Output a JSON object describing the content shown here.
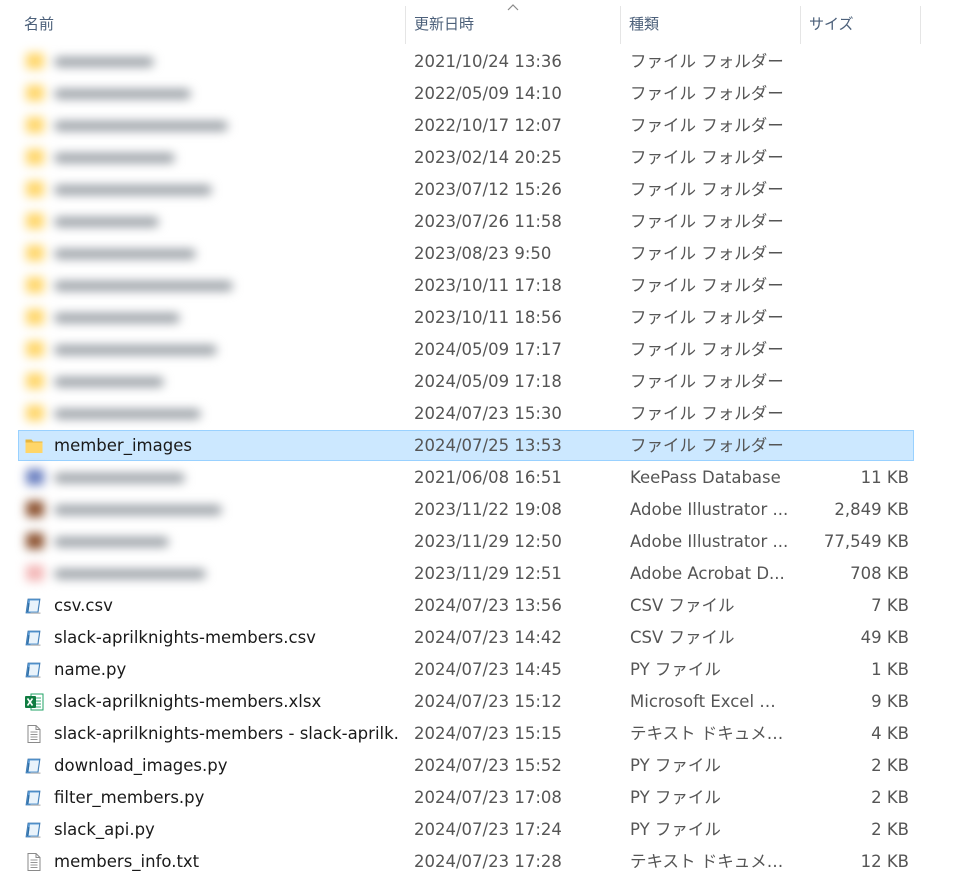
{
  "header": {
    "name_label": "名前",
    "date_label": "更新日時",
    "type_label": "種類",
    "size_label": "サイズ"
  },
  "colors": {
    "selection_bg": "#cce8ff",
    "selection_border": "#99d1ff",
    "header_text": "#4c607a",
    "secondary_text": "#555555",
    "folder_yellow": "#ffd669"
  },
  "rows": [
    {
      "name": "",
      "blurred": true,
      "icon": "folder-icon",
      "date": "2021/10/24 13:36",
      "type": "ファイル フォルダー",
      "size": ""
    },
    {
      "name": "",
      "blurred": true,
      "icon": "folder-icon",
      "date": "2022/05/09 14:10",
      "type": "ファイル フォルダー",
      "size": ""
    },
    {
      "name": "",
      "blurred": true,
      "icon": "folder-icon",
      "date": "2022/10/17 12:07",
      "type": "ファイル フォルダー",
      "size": ""
    },
    {
      "name": "",
      "blurred": true,
      "icon": "folder-icon",
      "date": "2023/02/14 20:25",
      "type": "ファイル フォルダー",
      "size": ""
    },
    {
      "name": "",
      "blurred": true,
      "icon": "folder-icon",
      "date": "2023/07/12 15:26",
      "type": "ファイル フォルダー",
      "size": ""
    },
    {
      "name": "",
      "blurred": true,
      "icon": "folder-icon",
      "date": "2023/07/26 11:58",
      "type": "ファイル フォルダー",
      "size": ""
    },
    {
      "name": "",
      "blurred": true,
      "icon": "folder-icon",
      "date": "2023/08/23 9:50",
      "type": "ファイル フォルダー",
      "size": ""
    },
    {
      "name": "",
      "blurred": true,
      "icon": "folder-icon",
      "date": "2023/10/11 17:18",
      "type": "ファイル フォルダー",
      "size": ""
    },
    {
      "name": "",
      "blurred": true,
      "icon": "folder-icon",
      "date": "2023/10/11 18:56",
      "type": "ファイル フォルダー",
      "size": ""
    },
    {
      "name": "",
      "blurred": true,
      "icon": "folder-icon",
      "date": "2024/05/09 17:17",
      "type": "ファイル フォルダー",
      "size": ""
    },
    {
      "name": "",
      "blurred": true,
      "icon": "folder-icon",
      "date": "2024/05/09 17:18",
      "type": "ファイル フォルダー",
      "size": ""
    },
    {
      "name": "",
      "blurred": true,
      "icon": "folder-icon",
      "date": "2024/07/23 15:30",
      "type": "ファイル フォルダー",
      "size": ""
    },
    {
      "name": "member_images",
      "blurred": false,
      "selected": true,
      "icon": "folder-icon",
      "date": "2024/07/25 13:53",
      "type": "ファイル フォルダー",
      "size": ""
    },
    {
      "name": "",
      "blurred": true,
      "icon": "keepass-icon",
      "date": "2021/06/08 16:51",
      "type": "KeePass Database",
      "size": "11 KB"
    },
    {
      "name": "",
      "blurred": true,
      "icon": "illustrator-icon",
      "date": "2023/11/22 19:08",
      "type": "Adobe Illustrator ...",
      "size": "2,849 KB"
    },
    {
      "name": "",
      "blurred": true,
      "icon": "illustrator-icon",
      "date": "2023/11/29 12:50",
      "type": "Adobe Illustrator ...",
      "size": "77,549 KB"
    },
    {
      "name": "",
      "blurred": true,
      "icon": "pdf-icon",
      "date": "2023/11/29 12:51",
      "type": "Adobe Acrobat D...",
      "size": "708 KB"
    },
    {
      "name": "csv.csv",
      "blurred": false,
      "icon": "script-file-icon",
      "date": "2024/07/23 13:56",
      "type": "CSV ファイル",
      "size": "7 KB"
    },
    {
      "name": "slack-aprilknights-members.csv",
      "blurred": false,
      "icon": "script-file-icon",
      "date": "2024/07/23 14:42",
      "type": "CSV ファイル",
      "size": "49 KB"
    },
    {
      "name": "name.py",
      "blurred": false,
      "icon": "script-file-icon",
      "date": "2024/07/23 14:45",
      "type": "PY ファイル",
      "size": "1 KB"
    },
    {
      "name": "slack-aprilknights-members.xlsx",
      "blurred": false,
      "icon": "excel-file-icon",
      "date": "2024/07/23 15:12",
      "type": "Microsoft Excel ワ...",
      "size": "9 KB"
    },
    {
      "name": "slack-aprilknights-members - slack-aprilk...",
      "blurred": false,
      "icon": "text-file-icon",
      "date": "2024/07/23 15:15",
      "type": "テキスト ドキュメント",
      "size": "4 KB"
    },
    {
      "name": "download_images.py",
      "blurred": false,
      "icon": "script-file-icon",
      "date": "2024/07/23 15:52",
      "type": "PY ファイル",
      "size": "2 KB"
    },
    {
      "name": "filter_members.py",
      "blurred": false,
      "icon": "script-file-icon",
      "date": "2024/07/23 17:08",
      "type": "PY ファイル",
      "size": "2 KB"
    },
    {
      "name": "slack_api.py",
      "blurred": false,
      "icon": "script-file-icon",
      "date": "2024/07/23 17:24",
      "type": "PY ファイル",
      "size": "2 KB"
    },
    {
      "name": "members_info.txt",
      "blurred": false,
      "icon": "text-file-icon",
      "date": "2024/07/23 17:28",
      "type": "テキスト ドキュメント",
      "size": "12 KB"
    }
  ]
}
